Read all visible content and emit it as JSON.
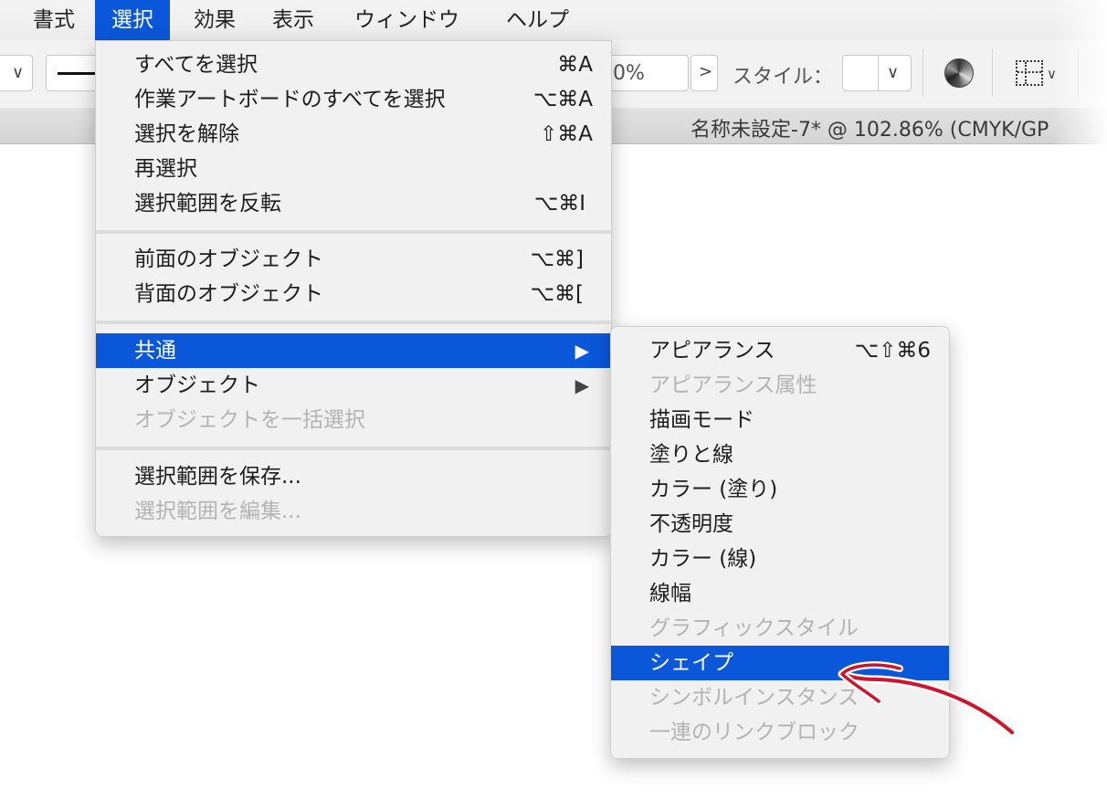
{
  "menubar": {
    "items": [
      "書式",
      "選択",
      "効果",
      "表示",
      "ウィンドウ",
      "ヘルプ"
    ]
  },
  "toolbar": {
    "zoom_partial": "0%",
    "style_label": "スタイル：",
    "chevron": "∨",
    "next": ">",
    "icons": [
      "stroke-line-icon",
      "color-wheel-icon",
      "grid-align-icon"
    ]
  },
  "document": {
    "title": "名称未設定-7* @ 102.86% (CMYK/GP"
  },
  "select_menu": {
    "groups": [
      [
        {
          "label": "すべてを選択",
          "shortcut": "⌘A"
        },
        {
          "label": "作業アートボードのすべてを選択",
          "shortcut": "⌥⌘A"
        },
        {
          "label": "選択を解除",
          "shortcut": "⇧⌘A"
        },
        {
          "label": "再選択",
          "shortcut": ""
        },
        {
          "label": "選択範囲を反転",
          "shortcut": "⌥⌘I"
        }
      ],
      [
        {
          "label": "前面のオブジェクト",
          "shortcut": "⌥⌘]"
        },
        {
          "label": "背面のオブジェクト",
          "shortcut": "⌥⌘["
        }
      ],
      [
        {
          "label": "共通",
          "submenu": true,
          "highlighted": true
        },
        {
          "label": "オブジェクト",
          "submenu": true
        },
        {
          "label": "オブジェクトを一括選択",
          "disabled": true
        }
      ],
      [
        {
          "label": "選択範囲を保存...",
          "shortcut": ""
        },
        {
          "label": "選択範囲を編集...",
          "disabled": true
        }
      ]
    ]
  },
  "common_submenu": {
    "items": [
      {
        "label": "アピアランス",
        "shortcut": "⌥⇧⌘6"
      },
      {
        "label": "アピアランス属性",
        "disabled": true
      },
      {
        "label": "描画モード"
      },
      {
        "label": "塗りと線"
      },
      {
        "label": "カラー (塗り)"
      },
      {
        "label": "不透明度"
      },
      {
        "label": "カラー (線)"
      },
      {
        "label": "線幅"
      },
      {
        "label": "グラフィックスタイル",
        "disabled": true
      },
      {
        "label": "シェイプ",
        "highlighted": true
      },
      {
        "label": "シンボルインスタンス",
        "disabled": true
      },
      {
        "label": "一連のリンクブロック",
        "disabled": true
      }
    ]
  },
  "colors": {
    "highlight": "#0a57d9",
    "annotation_arrow": "#d0142c"
  }
}
